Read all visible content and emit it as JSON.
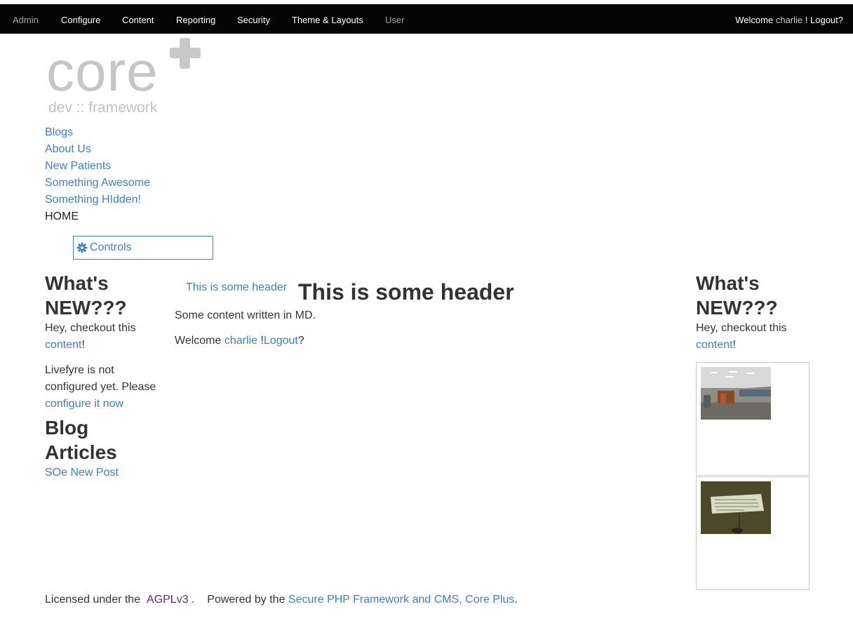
{
  "adminbar": {
    "items": [
      {
        "label": "Admin"
      },
      {
        "label": "Configure"
      },
      {
        "label": "Content"
      },
      {
        "label": "Reporting"
      },
      {
        "label": "Security"
      },
      {
        "label": "Theme & Layouts"
      },
      {
        "label": "User"
      }
    ],
    "welcome_prefix": "Welcome",
    "username": "charlie",
    "welcome_sep": "!",
    "logout": "Logout?"
  },
  "logo": {
    "word": "core",
    "sub": "dev :: framework",
    "icon": "plus-icon"
  },
  "nav": {
    "items": [
      {
        "label": "Blogs"
      },
      {
        "label": "About Us"
      },
      {
        "label": "New Patients"
      },
      {
        "label": "Something Awesome"
      },
      {
        "label": "Something HIdden!"
      },
      {
        "label": "HOME"
      }
    ]
  },
  "controls": {
    "label": "Controls",
    "icon": "gear-icon"
  },
  "left": {
    "whats_new_title": "What's NEW???",
    "checkout_prefix": "Hey, checkout this",
    "checkout_link": "content",
    "checkout_suffix": "!",
    "livefyre_text": "Livefyre is not configured yet. Please",
    "livefyre_link": "configure it now",
    "blog_title": "Blog Articles",
    "blog_post": "SOe New Post"
  },
  "center": {
    "header_link": "This is some header",
    "header_big": "This is some header",
    "md_text": "Some content written in MD.",
    "welcome_prefix": "Welcome",
    "username": "charlie",
    "sep": "!",
    "logout": "Logout",
    "q": "?"
  },
  "right": {
    "whats_new_title": "What's NEW???",
    "checkout_prefix": "Hey, checkout this",
    "checkout_link": "content",
    "checkout_suffix": "!"
  },
  "footer": {
    "licensed": "Licensed under the",
    "agpl": "AGPLv3",
    "dot1": ".",
    "powered": "Powered by the",
    "link": "Secure PHP Framework and CMS, Core Plus",
    "dot2": "."
  },
  "colors": {
    "link": "#3f7fc7",
    "bar": "#050505",
    "text": "#333333"
  }
}
